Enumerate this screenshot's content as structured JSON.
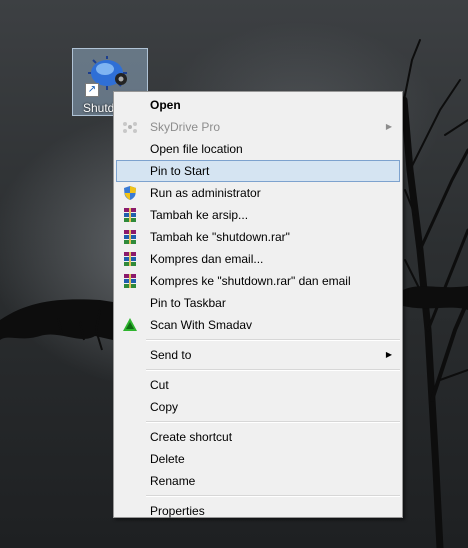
{
  "desktop": {
    "shortcut": {
      "label": "Shutdown",
      "icon": "gear-application-icon"
    }
  },
  "context_menu": {
    "items": [
      {
        "label": "Open",
        "bold": true
      },
      {
        "label": "SkyDrive Pro",
        "disabled": true,
        "submenu": true,
        "icon": "skydrive-icon"
      },
      {
        "label": "Open file location"
      },
      {
        "label": "Pin to Start",
        "highlighted": true
      },
      {
        "label": "Run as administrator",
        "icon": "uac-shield-icon"
      },
      {
        "label": "Tambah ke arsip...",
        "icon": "winrar-icon"
      },
      {
        "label": "Tambah ke \"shutdown.rar\"",
        "icon": "winrar-icon"
      },
      {
        "label": "Kompres dan email...",
        "icon": "winrar-icon"
      },
      {
        "label": "Kompres ke \"shutdown.rar\" dan email",
        "icon": "winrar-icon"
      },
      {
        "label": "Pin to Taskbar"
      },
      {
        "label": "Scan With Smadav",
        "icon": "smadav-icon"
      },
      {
        "label": "Send to",
        "submenu": true
      },
      {
        "label": "Cut"
      },
      {
        "label": "Copy"
      },
      {
        "label": "Create shortcut"
      },
      {
        "label": "Delete"
      },
      {
        "label": "Rename"
      },
      {
        "label": "Properties"
      }
    ],
    "submenu_arrow": "▶"
  },
  "colors": {
    "highlight": "#d5e4f2",
    "highlight_border": "#7da2ce",
    "menu_bg": "#f0f0f0"
  }
}
